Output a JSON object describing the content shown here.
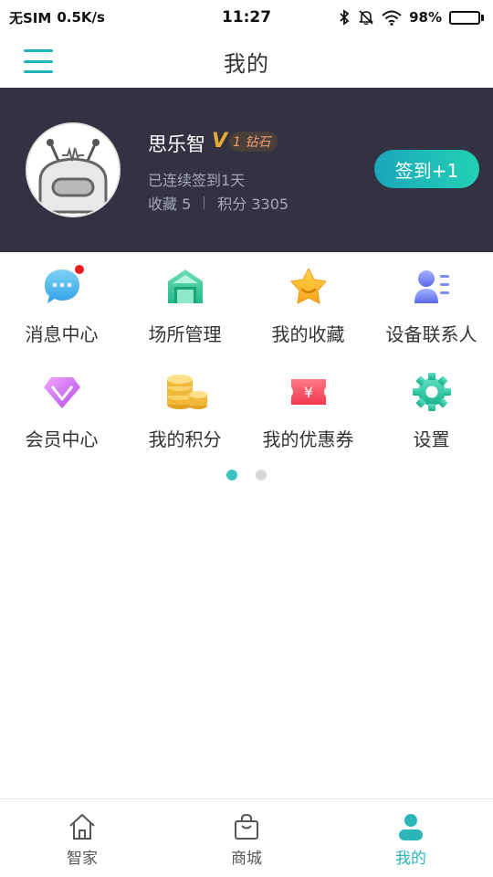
{
  "status_bar": {
    "carrier": "无SIM",
    "speed": "0.5K/s",
    "time": "11:27",
    "battery": "98%",
    "battery_level": 0.98
  },
  "header": {
    "title": "我的"
  },
  "profile": {
    "name": "思乐智",
    "vip_level": "1",
    "vip_tier": "钻石",
    "signed_text": "已连续签到1天",
    "favorites_text": "收藏 5",
    "points_text": "积分 3305",
    "checkin_label": "签到+1"
  },
  "grid": {
    "rows": [
      [
        {
          "label": "消息中心",
          "icon": "message-icon"
        },
        {
          "label": "场所管理",
          "icon": "home-building-icon"
        },
        {
          "label": "我的收藏",
          "icon": "star-icon"
        },
        {
          "label": "设备联系人",
          "icon": "contacts-icon"
        }
      ],
      [
        {
          "label": "会员中心",
          "icon": "diamond-icon"
        },
        {
          "label": "我的积分",
          "icon": "coins-icon"
        },
        {
          "label": "我的优惠券",
          "icon": "coupon-icon"
        },
        {
          "label": "设置",
          "icon": "gear-icon"
        }
      ]
    ]
  },
  "pagination": {
    "pages": 2,
    "active": 1
  },
  "bottom_nav": {
    "items": [
      {
        "label": "智家",
        "icon": "home-icon"
      },
      {
        "label": "商城",
        "icon": "shopping-bag-icon"
      },
      {
        "label": "我的",
        "icon": "person-icon",
        "active": true
      }
    ]
  },
  "colors": {
    "accent": "#2bb7b9",
    "profile_bg": "#323242",
    "notification_dot": "#e62020"
  }
}
